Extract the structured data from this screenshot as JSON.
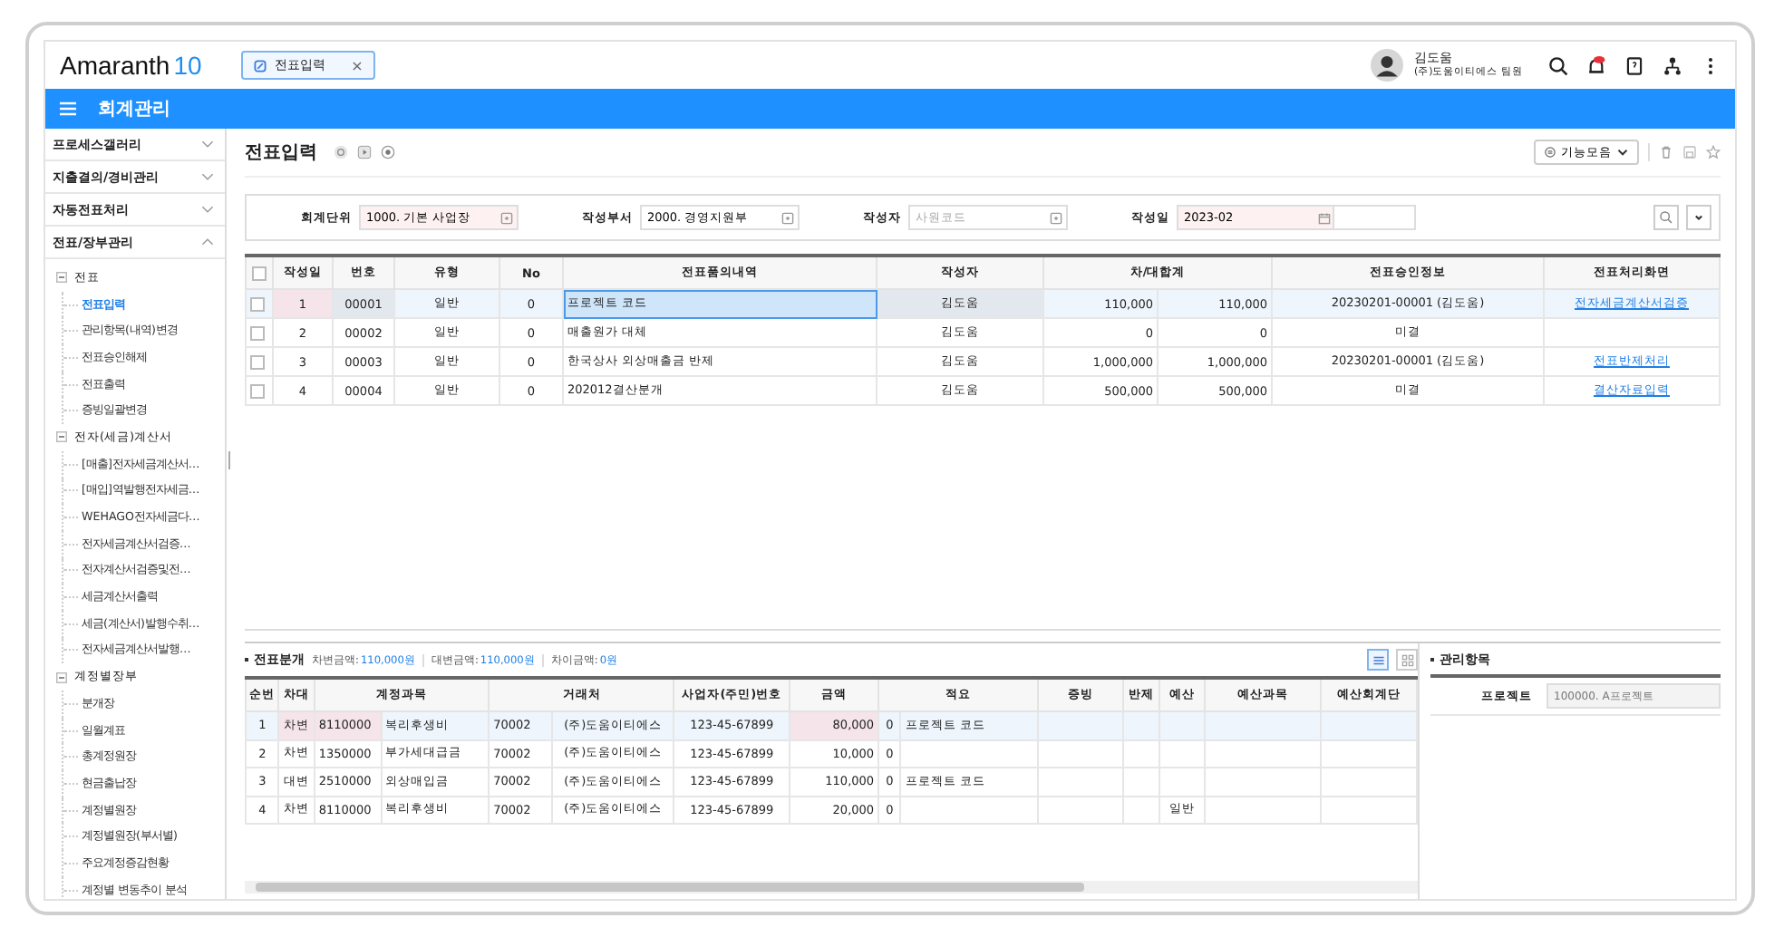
{
  "header": {
    "logo": "Amaranth",
    "logo_version": "10",
    "tabs": [
      {
        "label": "전표입력",
        "close": "×",
        "selected": true
      }
    ],
    "user": {
      "name": "김도움",
      "org": "(주)도움이티에스 팀원"
    }
  },
  "module_bar": {
    "title": "회계관리"
  },
  "sidebar": {
    "sections": [
      {
        "label": "프로세스갤러리",
        "expanded": false
      },
      {
        "label": "지출결의/경비관리",
        "expanded": false
      },
      {
        "label": "자동전표처리",
        "expanded": false
      },
      {
        "label": "전표/장부관리",
        "expanded": true,
        "children": [
          {
            "label": "전표",
            "expanded": true,
            "children": [
              {
                "label": "전표입력",
                "selected": true
              },
              {
                "label": "관리항목(내역)변경",
                "selected": false
              },
              {
                "label": "전표승인해제",
                "selected": false
              },
              {
                "label": "전표출력",
                "selected": false
              },
              {
                "label": "증빙일괄변경",
                "selected": false
              }
            ]
          },
          {
            "label": "전자(세금)계산서",
            "expanded": true,
            "children": [
              {
                "label": "[매출]전자세금계산서…",
                "selected": false
              },
              {
                "label": "[매입]역발행전자세금…",
                "selected": false
              },
              {
                "label": "WEHAGO전자세금다…",
                "selected": false
              },
              {
                "label": "전자세금계산서검증…",
                "selected": false
              },
              {
                "label": "전자계산서검증및전…",
                "selected": false
              },
              {
                "label": "세금계산서출력",
                "selected": false
              },
              {
                "label": "세금(계산서)발행수취…",
                "selected": false
              },
              {
                "label": "전자세금계산서발행…",
                "selected": false
              }
            ]
          },
          {
            "label": "계정별장부",
            "expanded": true,
            "children": [
              {
                "label": "분개장",
                "selected": false
              },
              {
                "label": "일월계표",
                "selected": false
              },
              {
                "label": "총계정원장",
                "selected": false
              },
              {
                "label": "현금출납장",
                "selected": false
              },
              {
                "label": "계정별원장",
                "selected": false
              },
              {
                "label": "계정별원장(부서별)",
                "selected": false
              },
              {
                "label": "주요계정증감현황",
                "selected": false
              },
              {
                "label": "계정별 변동추이 분석",
                "selected": false
              }
            ]
          }
        ]
      }
    ]
  },
  "page": {
    "title": "전표입력",
    "function_button": "기능모음"
  },
  "filters": [
    {
      "label": "회계단위",
      "value": "1000. 기본 사업장",
      "required": true,
      "kind": "code"
    },
    {
      "label": "작성부서",
      "value": "2000. 경영지원부",
      "required": false,
      "kind": "code"
    },
    {
      "label": "작성자",
      "placeholder": "사원코드",
      "required": false,
      "kind": "code"
    },
    {
      "label": "작성일",
      "value": "2023-02",
      "required": true,
      "kind": "date"
    }
  ],
  "voucher_table": {
    "all_checked": false,
    "columns": [
      "작성일",
      "번호",
      "유형",
      "No",
      "전표품의내역",
      "작성자",
      "차/대합계",
      "전표승인정보",
      "전표처리화면"
    ],
    "rows": [
      {
        "selected": true,
        "checked": false,
        "day": "1",
        "number": "00001",
        "type": "일반",
        "no": "0",
        "description": "프로젝트 코드",
        "author": "김도움",
        "debit": "110,000",
        "credit": "110,000",
        "approval": "20230201-00001 (김도움)",
        "link": "전자세금계산서검증"
      },
      {
        "selected": false,
        "checked": false,
        "day": "2",
        "number": "00002",
        "type": "일반",
        "no": "0",
        "description": "매출원가 대체",
        "author": "김도움",
        "debit": "0",
        "credit": "0",
        "approval": "미결",
        "link": ""
      },
      {
        "selected": false,
        "checked": false,
        "day": "3",
        "number": "00003",
        "type": "일반",
        "no": "0",
        "description": "한국상사 외상매출금 반제",
        "author": "김도움",
        "debit": "1,000,000",
        "credit": "1,000,000",
        "approval": "20230201-00001 (김도움)",
        "link": "전표반제처리"
      },
      {
        "selected": false,
        "checked": false,
        "day": "4",
        "number": "00004",
        "type": "일반",
        "no": "0",
        "description": "202012결산분개",
        "author": "김도움",
        "debit": "500,000",
        "credit": "500,000",
        "approval": "미결",
        "link": "결산자료입력"
      }
    ]
  },
  "journal": {
    "title": "전표분개",
    "totals": [
      {
        "label": "차변금액:",
        "value": "110,000원"
      },
      {
        "label": "대변금액:",
        "value": "110,000원"
      },
      {
        "label": "차이금액:",
        "value": "0원"
      }
    ],
    "columns": [
      "순번",
      "차대",
      "계정과목",
      "거래처",
      "사업자(주민)번호",
      "금액",
      "적요",
      "증빙",
      "반제",
      "예산",
      "예산과목",
      "예산회계단"
    ],
    "rows": [
      {
        "selected": true,
        "seq": "1",
        "side": "차변",
        "account_code": "8110000",
        "account": "복리후생비",
        "partner_code": "70002",
        "partner": "(주)도움이티에스",
        "biz_no": "123-45-67899",
        "amount": "80,000",
        "memo_code": "0",
        "memo": "프로젝트 코드",
        "budget": ""
      },
      {
        "selected": false,
        "seq": "2",
        "side": "차변",
        "account_code": "1350000",
        "account": "부가세대급금",
        "partner_code": "70002",
        "partner": "(주)도움이티에스",
        "biz_no": "123-45-67899",
        "amount": "10,000",
        "memo_code": "0",
        "memo": "",
        "budget": ""
      },
      {
        "selected": false,
        "seq": "3",
        "side": "대변",
        "account_code": "2510000",
        "account": "외상매입금",
        "partner_code": "70002",
        "partner": "(주)도움이티에스",
        "biz_no": "123-45-67899",
        "amount": "110,000",
        "memo_code": "0",
        "memo": "프로젝트 코드",
        "budget": ""
      },
      {
        "selected": false,
        "seq": "4",
        "side": "차변",
        "account_code": "8110000",
        "account": "복리후생비",
        "partner_code": "70002",
        "partner": "(주)도움이티에스",
        "biz_no": "123-45-67899",
        "amount": "20,000",
        "memo_code": "0",
        "memo": "",
        "budget": "일반"
      }
    ]
  },
  "management": {
    "title": "관리항목",
    "items": [
      {
        "label": "프로젝트",
        "value": "100000. A프로젝트"
      }
    ]
  }
}
